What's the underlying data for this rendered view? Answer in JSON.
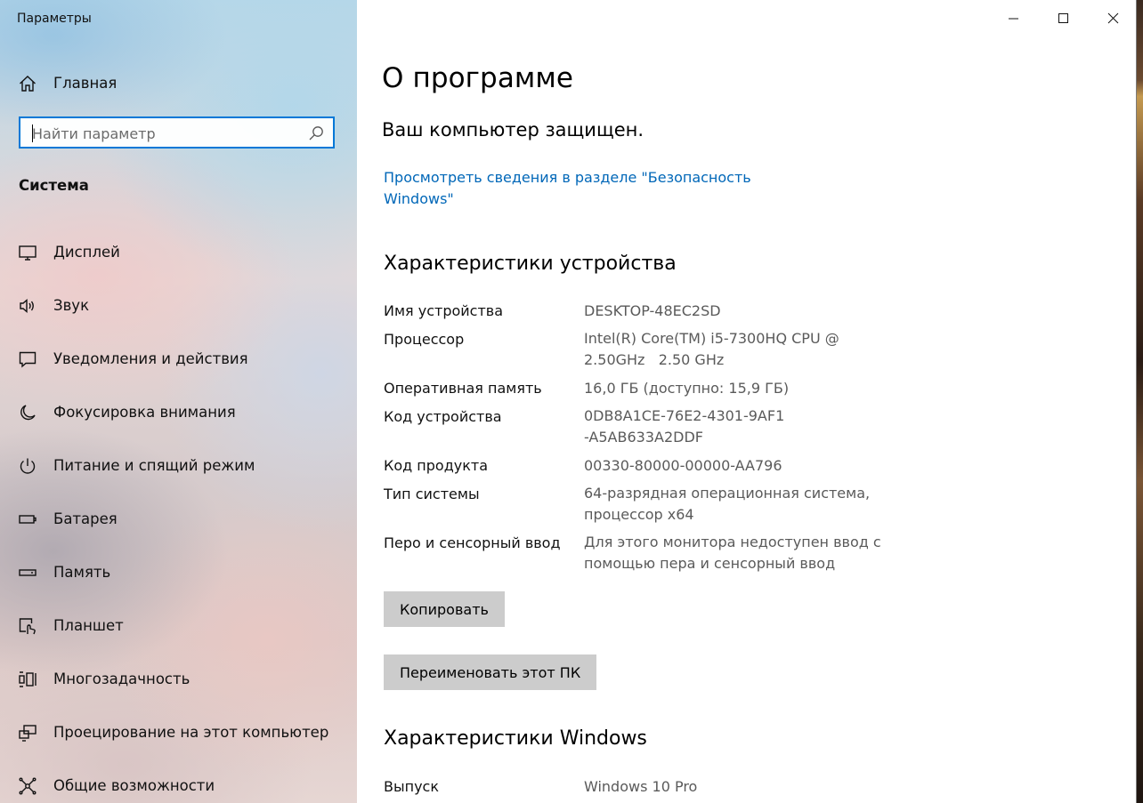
{
  "window": {
    "title": "Параметры"
  },
  "sidebar": {
    "home_label": "Главная",
    "search_placeholder": "Найти параметр",
    "section_title": "Система",
    "items": [
      {
        "label": "Дисплей",
        "icon": "display-icon"
      },
      {
        "label": "Звук",
        "icon": "speaker-icon"
      },
      {
        "label": "Уведомления и действия",
        "icon": "notification-icon"
      },
      {
        "label": "Фокусировка внимания",
        "icon": "moon-icon"
      },
      {
        "label": "Питание и спящий режим",
        "icon": "power-icon"
      },
      {
        "label": "Батарея",
        "icon": "battery-icon"
      },
      {
        "label": "Память",
        "icon": "storage-icon"
      },
      {
        "label": "Планшет",
        "icon": "tablet-icon"
      },
      {
        "label": "Многозадачность",
        "icon": "multitasking-icon"
      },
      {
        "label": "Проецирование на этот компьютер",
        "icon": "projecting-icon"
      },
      {
        "label": "Общие возможности",
        "icon": "shared-experiences-icon"
      }
    ]
  },
  "main": {
    "title": "О программе",
    "protection_status": "Ваш компьютер защищен.",
    "security_link": "Просмотреть сведения в разделе \"Безопасность Windows\"",
    "device_specs": {
      "heading": "Характеристики устройства",
      "rows": [
        {
          "key": "Имя устройства",
          "value": "DESKTOP-48EC2SD"
        },
        {
          "key": "Процессор",
          "value": "Intel(R) Core(TM) i5-7300HQ CPU @ 2.50GHz   2.50 GHz"
        },
        {
          "key": "Оперативная память",
          "value": "16,0 ГБ (доступно: 15,9 ГБ)"
        },
        {
          "key": "Код устройства",
          "value": "0DB8A1CE-76E2-4301-9AF1-A5AB633A2DDF"
        },
        {
          "key": "Код продукта",
          "value": "00330-80000-00000-AA796"
        },
        {
          "key": "Тип системы",
          "value": "64-разрядная операционная система, процессор x64"
        },
        {
          "key": "Перо и сенсорный ввод",
          "value": "Для этого монитора недоступен ввод с помощью пера и сенсорный ввод"
        }
      ],
      "copy_button": "Копировать",
      "rename_button": "Переименовать этот ПК"
    },
    "windows_specs": {
      "heading": "Характеристики Windows",
      "rows": [
        {
          "key": "Выпуск",
          "value": "Windows 10 Pro"
        }
      ]
    }
  },
  "colors": {
    "accent": "#0078d7",
    "link": "#0067b8",
    "button": "#cccccc",
    "secondary_text": "#5a5a5a"
  }
}
